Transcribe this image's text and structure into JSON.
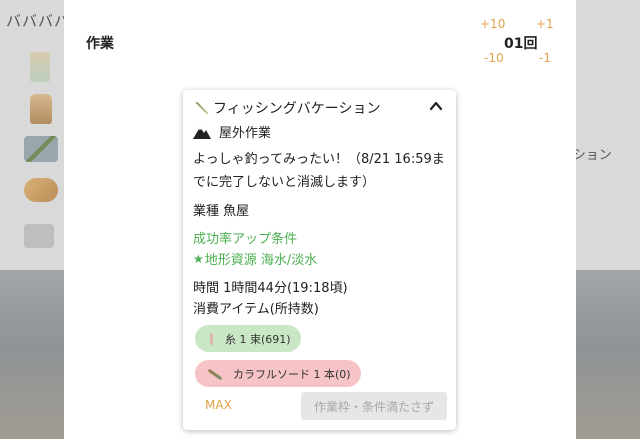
{
  "background": {
    "title": "ババババ",
    "side_text": "ーション"
  },
  "dialog": {
    "title": "作業",
    "adjust": {
      "plus10": "+10",
      "plus1": "+1",
      "minus10": "-10",
      "minus1": "-1"
    },
    "count": "01回"
  },
  "job_card": {
    "name": "フィッシングバケーション",
    "type": "屋外作業",
    "description": "よっしゃ釣ってみったい！（8/21 16:59までに完了しないと消滅します）",
    "industry": "業種 魚屋",
    "success_condition_title": "成功率アップ条件",
    "success_condition_item": "地形資源 海水/淡水",
    "time": "時間 1時間44分(19:18頃)",
    "consume_title": "消費アイテム(所持数)",
    "items": [
      {
        "icon": "thread-icon",
        "label": "糸 1 束(691)",
        "status_color": "#c9e7c4"
      },
      {
        "icon": "colorful-sword-icon",
        "label": "カラフルソード 1 本(0)",
        "status_color": "#f6c3c6"
      }
    ],
    "max_label": "MAX",
    "action_label": "作業枠・条件満たさず"
  },
  "colors": {
    "accent_orange": "#e2a24a",
    "success_green": "#4caf50",
    "disabled_gray": "#e6e6e6"
  }
}
